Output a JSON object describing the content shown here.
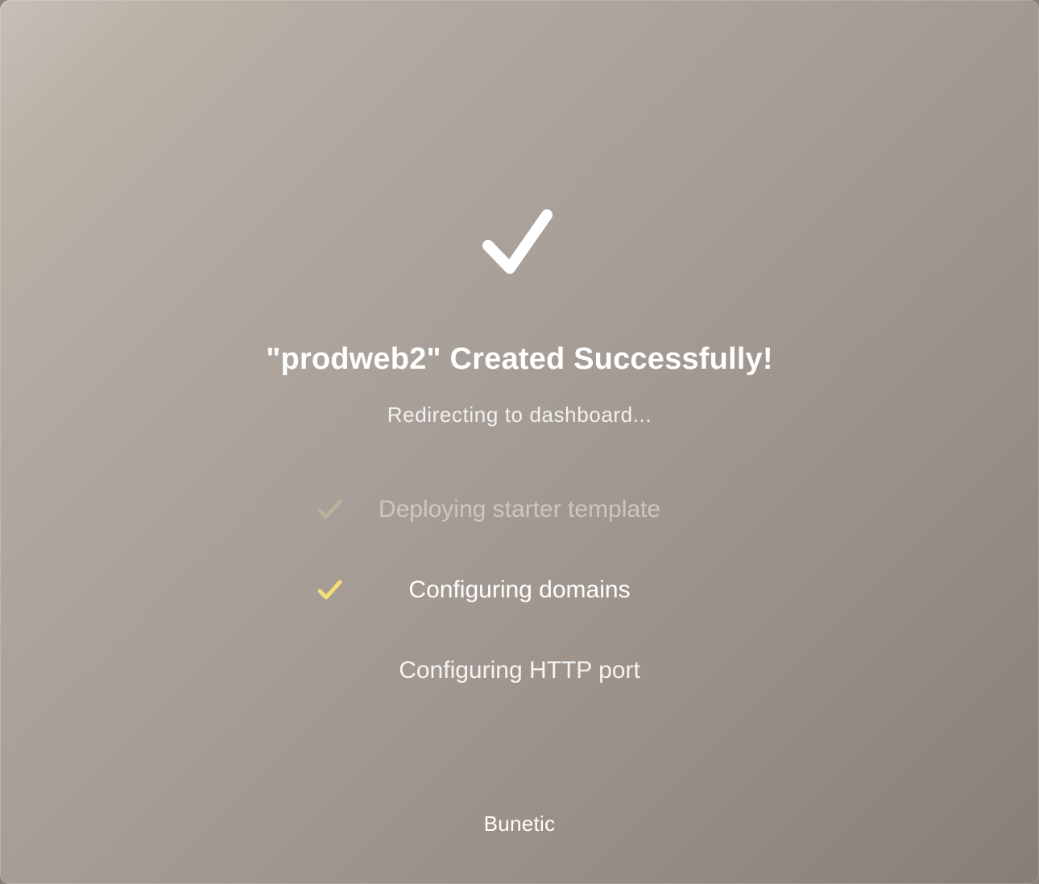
{
  "success": {
    "icon": "checkmark-icon",
    "title": "\"prodweb2\" Created Successfully!",
    "subtitle": "Redirecting to dashboard..."
  },
  "steps": [
    {
      "label": "Deploying starter template",
      "status": "done",
      "icon": "checkmark-icon",
      "icon_color": "#c2b59b"
    },
    {
      "label": "Configuring domains",
      "status": "done",
      "icon": "checkmark-icon",
      "icon_color": "#f3df79"
    },
    {
      "label": "Configuring HTTP port",
      "status": "pending"
    }
  ],
  "footer": {
    "brand": "Bunetic"
  },
  "colors": {
    "background_start": "#c6c0b9",
    "background_end": "#887e75",
    "text_primary": "#ffffff",
    "check_active": "#f3df79",
    "check_faded": "#c2b59b"
  }
}
